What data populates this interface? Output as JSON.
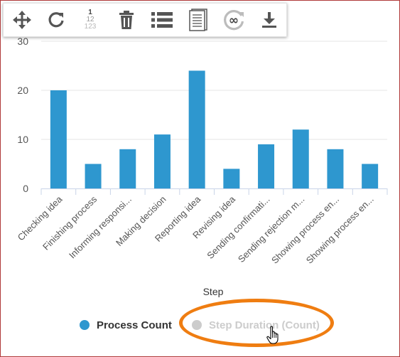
{
  "toolbar": {
    "buttons": [
      {
        "name": "move-icon",
        "label": "Move"
      },
      {
        "name": "refresh-icon",
        "label": "Refresh"
      },
      {
        "name": "numbering-icon",
        "label": "Numbering",
        "lines": [
          "1",
          "12",
          "123"
        ]
      },
      {
        "name": "trash-icon",
        "label": "Delete"
      },
      {
        "name": "list-icon",
        "label": "List"
      },
      {
        "name": "document-icon",
        "label": "Document"
      },
      {
        "name": "infinity-refresh-icon",
        "label": "Infinity",
        "glyph": "∞"
      },
      {
        "name": "download-icon",
        "label": "Download"
      }
    ]
  },
  "colors": {
    "bar": "#2e97cf",
    "grid": "#e6e6e6",
    "axis": "#c9d4e8",
    "legend_active": "#333333",
    "legend_inactive": "#cccccc",
    "highlight": "#ef7d11",
    "frame": "#b03a3a"
  },
  "chart_data": {
    "type": "bar",
    "title": "",
    "xlabel": "Step",
    "ylabel": "",
    "y_ticks": [
      "0",
      "10",
      "20",
      "30"
    ],
    "ylim": [
      0,
      30
    ],
    "grid": true,
    "legend_position": "bottom",
    "categories": [
      "Checking idea",
      "Finishing process",
      "Informing responsi...",
      "Making decision",
      "Reporting idea",
      "Revising idea",
      "Sending confirmati...",
      "Sending rejection m...",
      "Showing process en...",
      "Showing process en..."
    ],
    "series": [
      {
        "name": "Process Count",
        "values": [
          20,
          5,
          8,
          11,
          24,
          4,
          9,
          12,
          8,
          5
        ],
        "visible": true
      },
      {
        "name": "Step Duration (Count)",
        "values": [],
        "visible": false
      }
    ]
  }
}
